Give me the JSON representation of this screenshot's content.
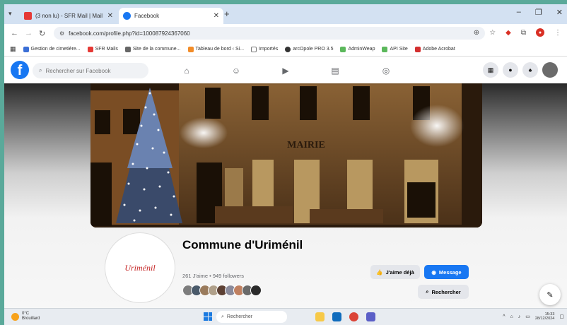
{
  "browser": {
    "tabs": [
      {
        "title": "(3 non lu) - SFR Mail | Mail",
        "active": false,
        "favicon_color": "#e53935"
      },
      {
        "title": "Facebook",
        "active": true,
        "favicon_color": "#1877f2"
      }
    ],
    "url": "facebook.com/profile.php?id=100087924367060",
    "bookmarks": [
      {
        "label": "Gestion de cimetière...",
        "color": "#3b6fd6"
      },
      {
        "label": "SFR Mails",
        "color": "#e53935"
      },
      {
        "label": "Site de la commune...",
        "color": "#666666"
      },
      {
        "label": "Tableau de bord ‹ Si...",
        "color": "#f28c28"
      },
      {
        "label": "Importés",
        "color": "#888888"
      },
      {
        "label": "arcOpole PRO 3.5",
        "color": "#333333"
      },
      {
        "label": "AdminWeap",
        "color": "#5cb85c"
      },
      {
        "label": "API Site",
        "color": "#5cb85c"
      },
      {
        "label": "Adobe Acrobat",
        "color": "#d32f2f"
      }
    ]
  },
  "facebook": {
    "search_placeholder": "Rechercher sur Facebook",
    "cover_text": "MAIRIE",
    "page": {
      "name": "Commune d'Uriménil",
      "stats": "261 J'aime • 949 followers",
      "avatar_logo": "Uriménil"
    },
    "buttons": {
      "like": "J'aime déjà",
      "message": "Message",
      "search": "Rechercher"
    }
  },
  "taskbar": {
    "weather_temp": "0°C",
    "weather_desc": "Brouillard",
    "search_label": "Rechercher",
    "time": "15:33",
    "date": "28/12/2024"
  },
  "colors": {
    "facebook_blue": "#1877f2",
    "chrome_tabstrip": "#d3e1f2"
  }
}
